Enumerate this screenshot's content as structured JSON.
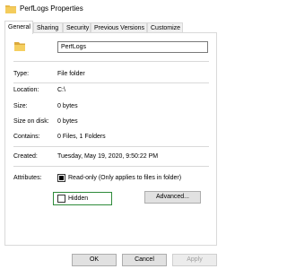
{
  "window": {
    "title": "PerfLogs Properties"
  },
  "tabs": [
    {
      "label": "General"
    },
    {
      "label": "Sharing"
    },
    {
      "label": "Security"
    },
    {
      "label": "Previous Versions"
    },
    {
      "label": "Customize"
    }
  ],
  "general": {
    "name_value": "PerfLogs",
    "type": {
      "label": "Type:",
      "value": "File folder"
    },
    "location": {
      "label": "Location:",
      "value": "C:\\"
    },
    "size": {
      "label": "Size:",
      "value": "0 bytes"
    },
    "size_on_disk": {
      "label": "Size on disk:",
      "value": "0 bytes"
    },
    "contains": {
      "label": "Contains:",
      "value": "0 Files, 1 Folders"
    },
    "created": {
      "label": "Created:",
      "value": "Tuesday, May 19, 2020, 9:50:22 PM"
    },
    "attributes": {
      "label": "Attributes:",
      "readonly_label": "Read-only (Only applies to files in folder)",
      "readonly_state": "indeterminate",
      "hidden_label": "Hidden",
      "hidden_checked": false,
      "highlight_color": "#2e8b3a",
      "advanced_label": "Advanced..."
    }
  },
  "buttons": {
    "ok": "OK",
    "cancel": "Cancel",
    "apply": "Apply"
  }
}
